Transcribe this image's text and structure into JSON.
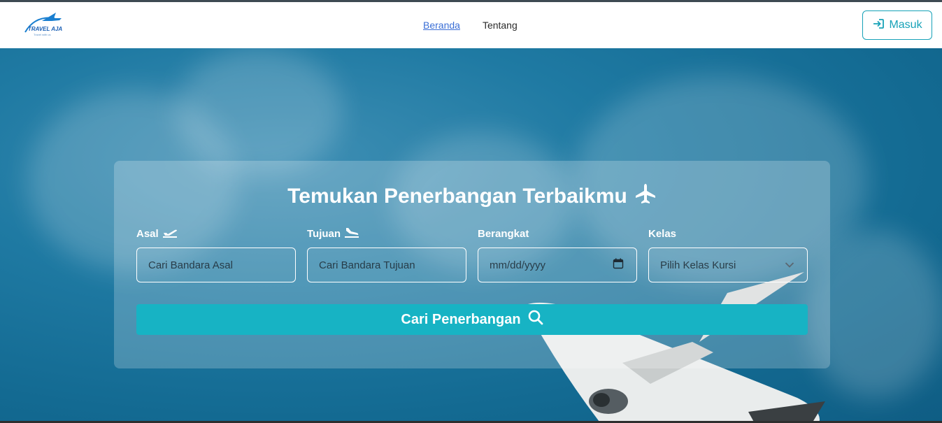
{
  "brand": {
    "name": "TRAVEL AJA",
    "tagline": "Travel with us"
  },
  "nav": {
    "items": [
      {
        "label": "Beranda",
        "active": true
      },
      {
        "label": "Tentang",
        "active": false
      }
    ]
  },
  "login": {
    "label": "Masuk"
  },
  "search": {
    "title": "Temukan Penerbangan Terbaikmu",
    "fields": {
      "origin": {
        "label": "Asal",
        "placeholder": "Cari Bandara Asal"
      },
      "destination": {
        "label": "Tujuan",
        "placeholder": "Cari Bandara Tujuan"
      },
      "departure": {
        "label": "Berangkat",
        "placeholder": "mm/dd/yyyy"
      },
      "class": {
        "label": "Kelas",
        "placeholder": "Pilih Kelas Kursi"
      }
    },
    "button_label": "Cari Penerbangan"
  },
  "colors": {
    "accent": "#17a2b8",
    "button": "#17b3c4",
    "nav_active": "#3b6fd6"
  },
  "icons": {
    "title": "plane-icon",
    "origin": "plane-departure-icon",
    "destination": "plane-arrival-icon",
    "departure": "calendar-icon",
    "class": "chevron-down-icon",
    "button": "search-icon",
    "login": "sign-in-icon"
  }
}
